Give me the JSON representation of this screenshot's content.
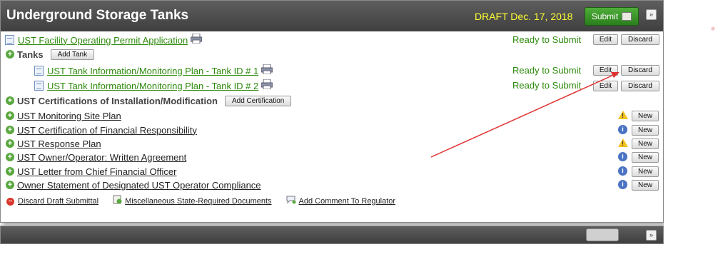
{
  "header": {
    "title": "Underground Storage Tanks",
    "draft": "DRAFT Dec. 17, 2018",
    "submit_label": "Submit"
  },
  "permit": {
    "link": "UST Facility Operating Permit Application",
    "status": "Ready to Submit",
    "edit": "Edit",
    "discard": "Discard"
  },
  "tanks": {
    "label": "Tanks",
    "add_label": "Add Tank",
    "items": [
      {
        "link": "UST Tank Information/Monitoring Plan - Tank ID # 1",
        "status": "Ready to Submit",
        "edit": "Edit",
        "discard": "Discard"
      },
      {
        "link": "UST Tank Information/Monitoring Plan - Tank ID # 2",
        "status": "Ready to Submit",
        "edit": "Edit",
        "discard": "Discard"
      }
    ]
  },
  "certifications": {
    "label": "UST Certifications of Installation/Modification",
    "add_label": "Add Certification"
  },
  "documents": [
    {
      "link": "UST Monitoring Site Plan",
      "indicator": "warning-icon",
      "new": "New"
    },
    {
      "link": "UST Certification of Financial Responsibility",
      "indicator": "info-icon",
      "new": "New"
    },
    {
      "link": "UST Response Plan",
      "indicator": "warning-icon",
      "new": "New"
    },
    {
      "link": "UST Owner/Operator: Written Agreement",
      "indicator": "info-icon",
      "new": "New"
    },
    {
      "link": "UST Letter from Chief Financial Officer",
      "indicator": "info-icon",
      "new": "New"
    },
    {
      "link": "Owner Statement of Designated UST Operator Compliance",
      "indicator": "info-icon",
      "new": "New"
    }
  ],
  "footer": {
    "discard_draft": "Discard Draft Submittal",
    "misc_docs": "Miscellaneous State-Required Documents",
    "add_comment": "Add Comment To Regulator"
  },
  "colors": {
    "accent_green": "#2d8a0b",
    "header_bg": "#4a4a4a",
    "draft_yellow": "#ffff33",
    "arrow_red": "#e03030"
  }
}
